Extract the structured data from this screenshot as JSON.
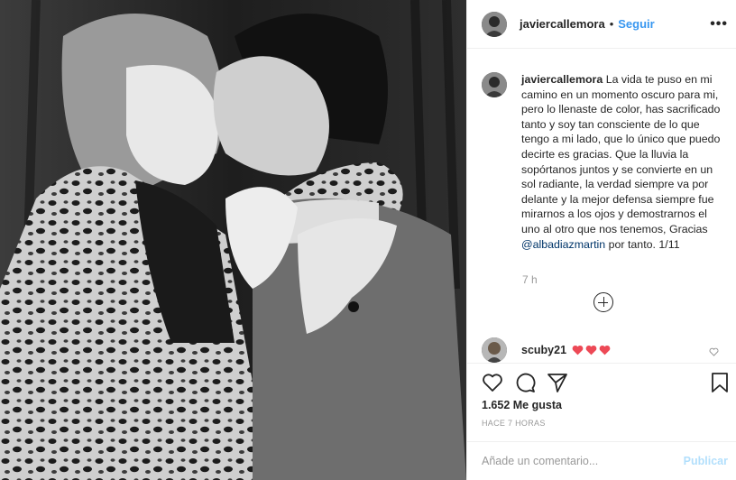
{
  "post": {
    "username": "javiercallemora",
    "follow_label": "Seguir",
    "separator": "•",
    "more_label": "•••"
  },
  "caption": {
    "username": "javiercallemora",
    "text": "La vida te puso en mi camino en un momento oscuro para mi, pero lo llenaste de color, has sacrificado tanto y soy tan consciente de lo que tengo a mi lado, que lo único que puedo decirte es gracias. Que la lluvia la sopórtanos juntos y se convierte en un sol radiante, la verdad siempre va por delante y la mejor defensa siempre fue mirarnos a los ojos y demostrarnos el uno al otro que nos tenemos, Gracias",
    "mention": "@albadiazmartin",
    "tail": " por tanto. 1/11",
    "time": "7 h"
  },
  "comment": {
    "username": "scuby21",
    "hearts": 3
  },
  "stats": {
    "likes": "1.652 Me gusta",
    "ago": "HACE 7 HORAS"
  },
  "composer": {
    "placeholder": "Añade un comentario...",
    "post_label": "Publicar"
  },
  "colors": {
    "accent": "#3897f0",
    "heart": "#ed4956",
    "publish_disabled": "#b2dffc"
  },
  "icons": {
    "like": "heart-outline-icon",
    "comment": "comment-bubble-icon",
    "share": "paper-plane-icon",
    "save": "bookmark-icon",
    "load_more": "plus-circle-icon"
  }
}
